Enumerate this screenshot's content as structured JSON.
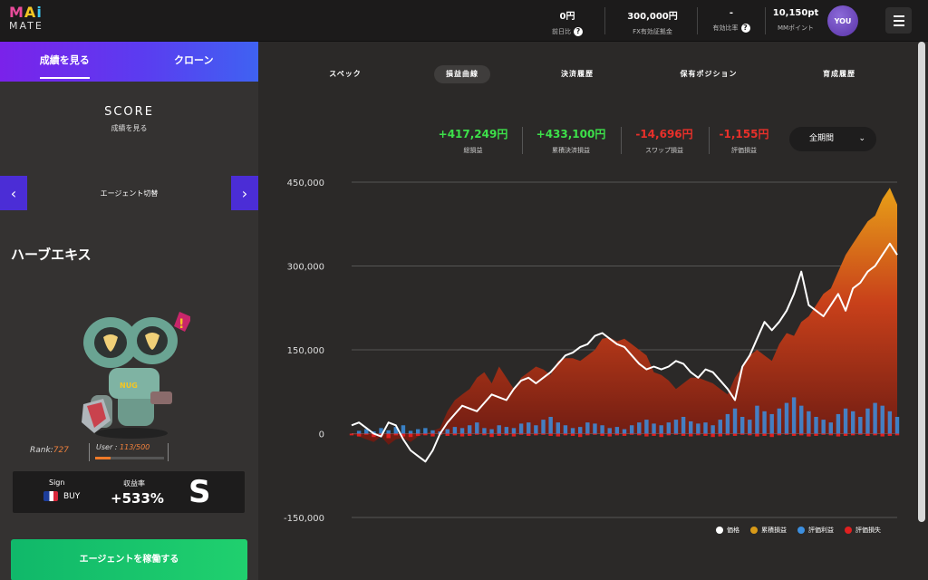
{
  "logo": {
    "line1": "MAi",
    "line2": "MATE"
  },
  "header": {
    "stats": [
      {
        "value": "0円",
        "label": "前日比",
        "help": true
      },
      {
        "value": "300,000円",
        "label": "FX有効証拠金",
        "help": false
      },
      {
        "value": "-",
        "label": "有効比率",
        "help": true
      },
      {
        "value": "10,150pt",
        "label": "MMポイント",
        "help": false
      }
    ],
    "avatar": "YOU"
  },
  "sidebar": {
    "tabs": [
      "成績を見る",
      "クローン"
    ],
    "score_title": "SCORE",
    "score_sub": "成績を見る",
    "agent_switch": "エージェント切替",
    "prev": "‹",
    "next": "›",
    "agent_name": "ハーブエキス",
    "rank_label": "Rank:",
    "rank_value": "727",
    "user_label": "User : ",
    "user_value": "113/500",
    "user_fill_fraction": 0.226,
    "sign_label": "Sign",
    "sign_value": "BUY",
    "return_label": "収益率",
    "return_value": "+533%",
    "grade": "S",
    "run_button": "エージェントを稼働する"
  },
  "tabs": [
    {
      "label": "スペック",
      "active": false
    },
    {
      "label": "損益曲線",
      "active": true
    },
    {
      "label": "決済履歴",
      "active": false
    },
    {
      "label": "保有ポジション",
      "active": false
    },
    {
      "label": "育成履歴",
      "active": false
    }
  ],
  "kpis": [
    {
      "value": "+417,249円",
      "label": "総損益",
      "color": "#3de04a"
    },
    {
      "value": "+433,100円",
      "label": "累積決済損益",
      "color": "#3de04a"
    },
    {
      "value": "-14,696円",
      "label": "スワップ損益",
      "color": "#e8302a"
    },
    {
      "value": "-1,155円",
      "label": "評価損益",
      "color": "#e8302a"
    }
  ],
  "period": "全期間",
  "colors": {
    "accent": "#5b3cf0",
    "profit": "#3de04a",
    "loss": "#e8302a",
    "run": "#16c46b"
  },
  "chart_data": {
    "type": "area",
    "ylim": [
      -150000,
      450000
    ],
    "yticks": [
      "450,000",
      "300,000",
      "150,000",
      "0",
      "-150,000"
    ],
    "ytick_values": [
      450000,
      300000,
      150000,
      0,
      -150000
    ],
    "legend_position": "bottom-right",
    "legend": [
      {
        "name": "価格",
        "color": "#ffffff"
      },
      {
        "name": "累積損益",
        "color": "#d89a18"
      },
      {
        "name": "評価利益",
        "color": "#3c8fe0"
      },
      {
        "name": "評価損失",
        "color": "#e02020"
      }
    ],
    "cumulative_pnl": [
      0,
      -5000,
      -10000,
      -15000,
      -5000,
      -20000,
      -10000,
      -8000,
      -15000,
      -5000,
      0,
      5000,
      10000,
      40000,
      60000,
      70000,
      80000,
      100000,
      110000,
      90000,
      120000,
      100000,
      80000,
      100000,
      110000,
      120000,
      115000,
      105000,
      130000,
      135000,
      135000,
      130000,
      140000,
      150000,
      170000,
      172000,
      165000,
      170000,
      160000,
      150000,
      140000,
      110000,
      105000,
      95000,
      80000,
      90000,
      100000,
      100000,
      95000,
      90000,
      80000,
      70000,
      100000,
      120000,
      140000,
      150000,
      140000,
      130000,
      160000,
      180000,
      175000,
      200000,
      210000,
      230000,
      250000,
      260000,
      290000,
      320000,
      340000,
      360000,
      380000,
      390000,
      420000,
      440000,
      410000
    ],
    "price": [
      15000,
      20000,
      10000,
      0,
      -5000,
      20000,
      15000,
      -10000,
      -30000,
      -40000,
      -50000,
      -30000,
      0,
      20000,
      35000,
      50000,
      45000,
      40000,
      55000,
      70000,
      65000,
      60000,
      80000,
      95000,
      100000,
      90000,
      100000,
      110000,
      125000,
      140000,
      145000,
      155000,
      160000,
      175000,
      180000,
      170000,
      160000,
      155000,
      140000,
      125000,
      115000,
      120000,
      115000,
      120000,
      130000,
      125000,
      110000,
      100000,
      115000,
      110000,
      95000,
      80000,
      60000,
      120000,
      140000,
      170000,
      200000,
      185000,
      200000,
      220000,
      250000,
      290000,
      230000,
      220000,
      210000,
      230000,
      250000,
      220000,
      260000,
      270000,
      290000,
      300000,
      320000,
      340000,
      320000
    ],
    "unrealized_profit": [
      0,
      5000,
      8000,
      4000,
      10000,
      6000,
      12000,
      15000,
      5000,
      8000,
      10000,
      6000,
      4000,
      8000,
      12000,
      10000,
      15000,
      20000,
      10000,
      8000,
      15000,
      12000,
      10000,
      18000,
      20000,
      15000,
      25000,
      30000,
      20000,
      15000,
      10000,
      12000,
      20000,
      18000,
      15000,
      10000,
      12000,
      8000,
      15000,
      20000,
      25000,
      18000,
      15000,
      20000,
      25000,
      30000,
      22000,
      18000,
      20000,
      15000,
      25000,
      35000,
      45000,
      30000,
      25000,
      50000,
      40000,
      35000,
      45000,
      55000,
      65000,
      50000,
      40000,
      30000,
      25000,
      20000,
      35000,
      45000,
      40000,
      30000,
      45000,
      55000,
      50000,
      40000,
      30000
    ],
    "unrealized_loss": [
      -3000,
      -5000,
      -2000,
      -6000,
      -4000,
      -8000,
      -3000,
      -5000,
      -6000,
      -4000,
      -3000,
      -5000,
      -2000,
      -4000,
      -3000,
      -5000,
      -4000,
      -2000,
      -3000,
      -6000,
      -4000,
      -3000,
      -5000,
      -2000,
      -4000,
      -3000,
      -2000,
      -4000,
      -5000,
      -3000,
      -4000,
      -6000,
      -3000,
      -2000,
      -4000,
      -5000,
      -3000,
      -4000,
      -2000,
      -3000,
      -5000,
      -4000,
      -6000,
      -3000,
      -2000,
      -4000,
      -5000,
      -3000,
      -4000,
      -6000,
      -5000,
      -3000,
      -4000,
      -2000,
      -3000,
      -5000,
      -4000,
      -6000,
      -3000,
      -2000,
      -4000,
      -3000,
      -5000,
      -4000,
      -2000,
      -3000,
      -5000,
      -4000,
      -3000,
      -2000,
      -4000,
      -3000,
      -5000,
      -4000,
      -3000
    ]
  }
}
